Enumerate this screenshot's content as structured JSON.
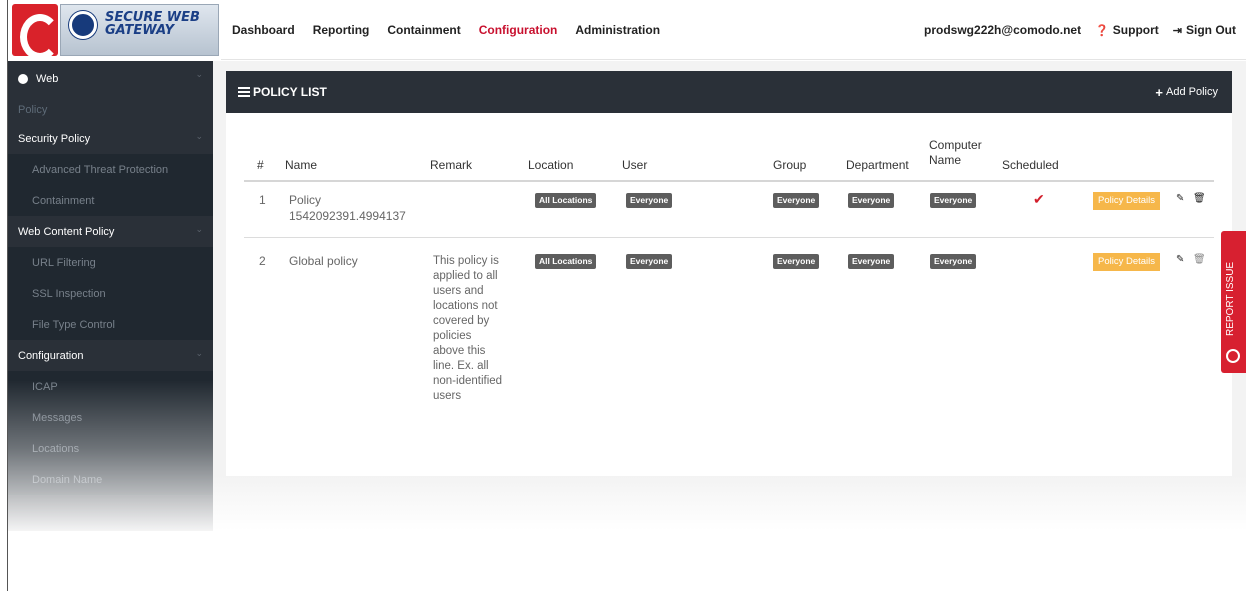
{
  "brand": {
    "line1": "SECURE WEB",
    "line2": "GATEWAY"
  },
  "nav": {
    "items": [
      {
        "label": "Dashboard"
      },
      {
        "label": "Reporting"
      },
      {
        "label": "Containment"
      },
      {
        "label": "Configuration"
      },
      {
        "label": "Administration"
      }
    ],
    "active": "Configuration",
    "active_color": "#c8102e",
    "user_email": "prodswg222h@comodo.net",
    "support_label": "Support",
    "signout_label": "Sign Out"
  },
  "sidebar": {
    "web_label": "Web",
    "policy_label": "Policy",
    "sections": [
      {
        "label": "Security Policy",
        "items": [
          "Advanced Threat Protection",
          "Containment"
        ]
      },
      {
        "label": "Web Content Policy",
        "items": [
          "URL Filtering",
          "SSL Inspection",
          "File Type Control"
        ]
      },
      {
        "label": "Configuration",
        "items": [
          "ICAP",
          "Messages",
          "Locations",
          "Domain Name"
        ]
      }
    ]
  },
  "panel": {
    "title": "POLICY LIST",
    "add_label": "Add Policy"
  },
  "table": {
    "headers": {
      "num": "#",
      "name": "Name",
      "remark": "Remark",
      "location": "Location",
      "user": "User",
      "group": "Group",
      "department": "Department",
      "computer_line1": "Computer",
      "computer_line2": "Name",
      "scheduled": "Scheduled"
    },
    "rows": [
      {
        "num": "1",
        "name_line1": "Policy",
        "name_line2": "1542092391.4994137",
        "remark": "",
        "location": "All Locations",
        "user": "Everyone",
        "group": "Everyone",
        "department": "Everyone",
        "computer": "Everyone",
        "scheduled": true,
        "details_label": "Policy Details"
      },
      {
        "num": "2",
        "name_line1": "Global policy",
        "name_line2": "",
        "remark_lines": [
          "This policy is",
          "applied to all",
          "users and",
          "locations not",
          "covered by",
          "policies",
          "above this",
          "line. Ex. all",
          "non-identified",
          "users"
        ],
        "location": "All Locations",
        "user": "Everyone",
        "group": "Everyone",
        "department": "Everyone",
        "computer": "Everyone",
        "scheduled": false,
        "details_label": "Policy Details"
      }
    ]
  },
  "report_issue": {
    "label": "REPORT ISSUE"
  },
  "colors": {
    "sidebar_bg": "#2a3038",
    "panel_header_bg": "#2a3038",
    "details_button": "#f6b74a",
    "badge": "#5d5d5d",
    "check": "#d21f2c",
    "report_tab": "#d72030"
  },
  "icons": {
    "support": "question-circle-icon",
    "signout": "sign-out-icon",
    "list": "list-icon",
    "add": "plus-icon",
    "edit": "pencil-icon",
    "delete": "trash-icon",
    "check": "check-icon",
    "chevron": "chevron-down-icon"
  }
}
